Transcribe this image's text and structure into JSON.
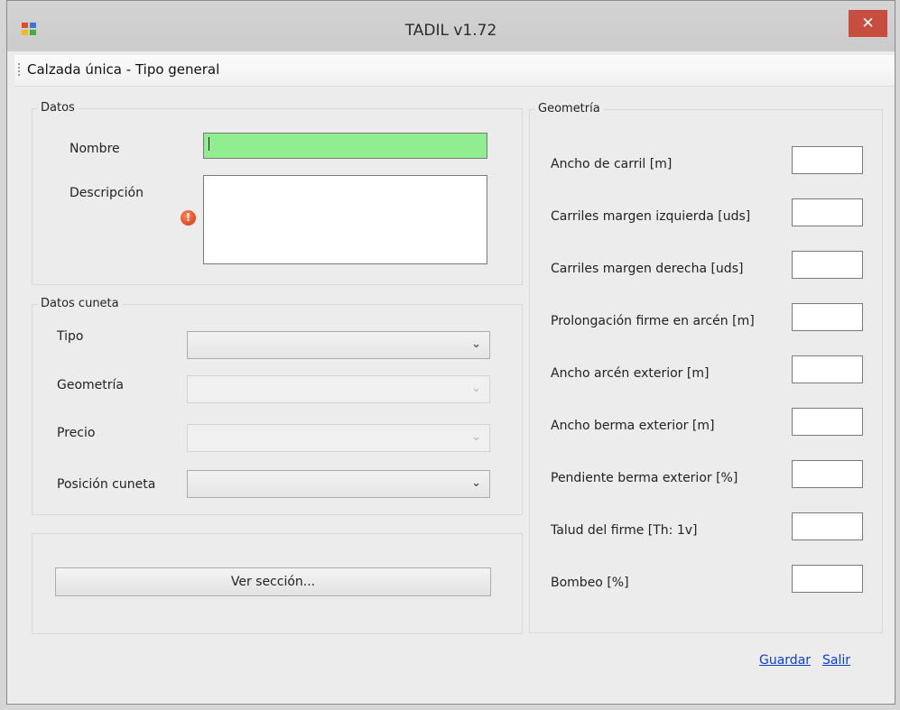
{
  "window": {
    "title": "TADIL v1.72",
    "close_glyph": "✕"
  },
  "menu": {
    "item": "Calzada única - Tipo general"
  },
  "datos": {
    "legend": "Datos",
    "nombre_label": "Nombre",
    "nombre_value": "",
    "descripcion_label": "Descripción",
    "descripcion_value": "",
    "error_glyph": "!"
  },
  "cuneta": {
    "legend": "Datos cuneta",
    "tipo_label": "Tipo",
    "geometria_label": "Geometría",
    "precio_label": "Precio",
    "posicion_label": "Posición cuneta",
    "arrow": "⌄"
  },
  "actions": {
    "ver_seccion": "Ver sección...",
    "guardar": "Guardar",
    "salir": "Salir"
  },
  "geometria": {
    "legend": "Geometría",
    "fields": [
      {
        "label": "Ancho de carril [m]",
        "value": ""
      },
      {
        "label": "Carriles margen izquierda  [uds]",
        "value": ""
      },
      {
        "label": "Carriles margen derecha [uds]",
        "value": ""
      },
      {
        "label": "Prolongación firme en arcén [m]",
        "value": ""
      },
      {
        "label": "Ancho arcén exterior [m]",
        "value": ""
      },
      {
        "label": "Ancho berma exterior [m]",
        "value": ""
      },
      {
        "label": "Pendiente berma exterior [%]",
        "value": ""
      },
      {
        "label": "Talud del firme [Th: 1v]",
        "value": ""
      },
      {
        "label": "Bombeo [%]",
        "value": ""
      }
    ]
  },
  "colors": {
    "nombre_field": "#90ee90",
    "close_button": "#c74e3f",
    "link": "#0a3ed6"
  }
}
